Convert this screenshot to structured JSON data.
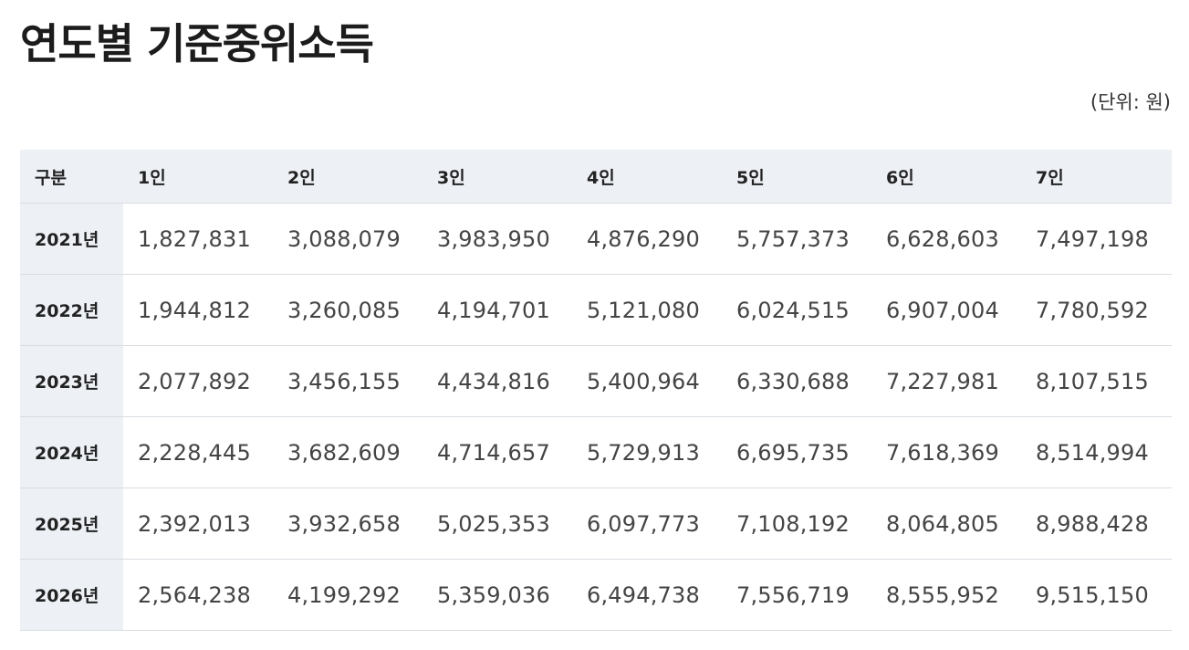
{
  "title": "연도별 기준중위소득",
  "unit": "(단위: 원)",
  "table": {
    "headers": [
      "구분",
      "1인",
      "2인",
      "3인",
      "4인",
      "5인",
      "6인",
      "7인"
    ],
    "rows": [
      {
        "year": "2021년",
        "values": [
          "1,827,831",
          "3,088,079",
          "3,983,950",
          "4,876,290",
          "5,757,373",
          "6,628,603",
          "7,497,198"
        ]
      },
      {
        "year": "2022년",
        "values": [
          "1,944,812",
          "3,260,085",
          "4,194,701",
          "5,121,080",
          "6,024,515",
          "6,907,004",
          "7,780,592"
        ]
      },
      {
        "year": "2023년",
        "values": [
          "2,077,892",
          "3,456,155",
          "4,434,816",
          "5,400,964",
          "6,330,688",
          "7,227,981",
          "8,107,515"
        ]
      },
      {
        "year": "2024년",
        "values": [
          "2,228,445",
          "3,682,609",
          "4,714,657",
          "5,729,913",
          "6,695,735",
          "7,618,369",
          "8,514,994"
        ]
      },
      {
        "year": "2025년",
        "values": [
          "2,392,013",
          "3,932,658",
          "5,025,353",
          "6,097,773",
          "7,108,192",
          "8,064,805",
          "8,988,428"
        ]
      },
      {
        "year": "2026년",
        "values": [
          "2,564,238",
          "4,199,292",
          "5,359,036",
          "6,494,738",
          "7,556,719",
          "8,555,952",
          "9,515,150"
        ]
      }
    ]
  },
  "colors": {
    "header_bg": "#edf0f5",
    "border": "#d9dce1",
    "text": "#444444"
  }
}
